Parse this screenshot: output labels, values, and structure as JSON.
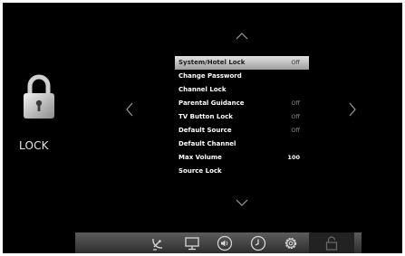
{
  "left_panel": {
    "title": "LOCK",
    "icon": "padlock-icon"
  },
  "nav": {
    "up_glyph": "︿",
    "down_glyph": "﹀",
    "left_glyph": "〈",
    "right_glyph": "〉"
  },
  "menu": {
    "items": [
      {
        "label": "System/Hotel Lock",
        "value": "Off",
        "selected": true
      },
      {
        "label": "Change Password",
        "value": ""
      },
      {
        "label": "Channel Lock",
        "value": ""
      },
      {
        "label": "Parental Guidance",
        "value": "Off"
      },
      {
        "label": "TV Button Lock",
        "value": "Off"
      },
      {
        "label": "Default Source",
        "value": "Off"
      },
      {
        "label": "Default Channel",
        "value": ""
      },
      {
        "label": "Max Volume",
        "value": "100"
      },
      {
        "label": "Source Lock",
        "value": ""
      }
    ]
  },
  "bottom_bar": {
    "icons": [
      "satellite-dish-icon",
      "display-icon",
      "speaker-icon",
      "clock-icon",
      "gear-icon",
      "lock-icon"
    ],
    "active": "lock-icon"
  },
  "colors": {
    "screen_bg": "#000000",
    "selection_bg": "#c8c8c8",
    "text": "#ffffff",
    "dim_text": "#8a8a8a"
  }
}
